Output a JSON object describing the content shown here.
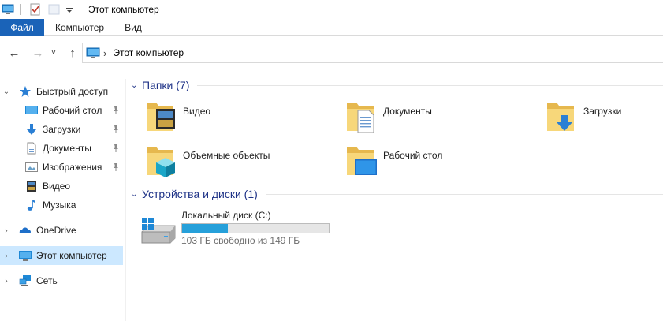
{
  "window": {
    "title": "Этот компьютер"
  },
  "ribbon": {
    "tabs": [
      {
        "label": "Файл"
      },
      {
        "label": "Компьютер"
      },
      {
        "label": "Вид"
      }
    ]
  },
  "address": {
    "path": "Этот компьютер",
    "separator": "›"
  },
  "nav": {
    "back_icon": "←",
    "forward_icon": "→",
    "recent_icon": "˅",
    "up_icon": "↑"
  },
  "sidebar": {
    "quick_access": "Быстрый доступ",
    "items": [
      {
        "label": "Рабочий стол",
        "pinned": true,
        "icon": "desktop-icon"
      },
      {
        "label": "Загрузки",
        "pinned": true,
        "icon": "downloads-icon"
      },
      {
        "label": "Документы",
        "pinned": true,
        "icon": "documents-icon"
      },
      {
        "label": "Изображения",
        "pinned": true,
        "icon": "pictures-icon"
      },
      {
        "label": "Видео",
        "pinned": false,
        "icon": "videos-icon"
      },
      {
        "label": "Музыка",
        "pinned": false,
        "icon": "music-icon"
      }
    ],
    "onedrive": "OneDrive",
    "this_pc": "Этот компьютер",
    "network": "Сеть"
  },
  "main": {
    "folders_header": "Папки (7)",
    "folders": [
      {
        "label": "Видео",
        "icon": "videos-folder-icon"
      },
      {
        "label": "Документы",
        "icon": "documents-folder-icon"
      },
      {
        "label": "Загрузки",
        "icon": "downloads-folder-icon"
      },
      {
        "label": "Объемные объекты",
        "icon": "3d-objects-folder-icon"
      },
      {
        "label": "Рабочий стол",
        "icon": "desktop-folder-icon"
      }
    ],
    "devices_header": "Устройства и диски (1)",
    "drive": {
      "name": "Локальный диск (C:)",
      "free_text": "103 ГБ свободно из 149 ГБ",
      "used_fraction": 0.31
    }
  },
  "colors": {
    "accent": "#1a63b8",
    "selection": "#cce8ff",
    "progress": "#26a0da",
    "group_header": "#1e3287"
  }
}
